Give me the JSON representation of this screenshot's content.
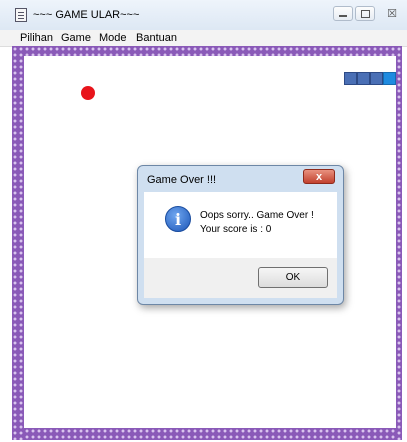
{
  "window": {
    "title": "~~~ GAME ULAR~~~",
    "icon": "app-icon",
    "controls": {
      "minimize": "minimize-icon",
      "maximize": "maximize-icon",
      "close": "☒"
    }
  },
  "menu": {
    "items": [
      {
        "label": "Pilihan"
      },
      {
        "label": "Game"
      },
      {
        "label": "Mode"
      },
      {
        "label": "Bantuan"
      }
    ]
  },
  "board": {
    "wall_color": "#8a5ab8",
    "food_color": "#e8141b",
    "snake_colors": {
      "body": "#4a6fb5",
      "head": "#1f8be0"
    }
  },
  "dialog": {
    "title": "Game Over !!!",
    "close_label": "x",
    "icon": "info-icon",
    "icon_glyph": "i",
    "message_line1": "Oops sorry.. Game Over !",
    "message_line2": "Your score is : 0",
    "ok_label": "OK"
  }
}
